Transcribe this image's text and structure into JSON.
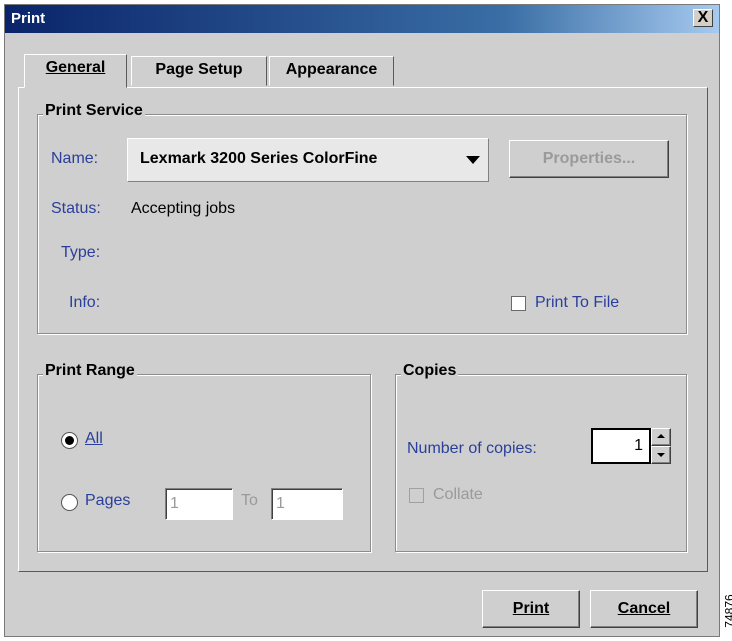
{
  "window": {
    "title": "Print",
    "close_glyph": "X"
  },
  "tabs": [
    {
      "label": "General",
      "selected": true
    },
    {
      "label": "Page Setup",
      "selected": false
    },
    {
      "label": "Appearance",
      "selected": false
    }
  ],
  "print_service": {
    "legend": "Print Service",
    "name_label": "Name:",
    "printer_name": "Lexmark 3200 Series ColorFine",
    "properties_button": "Properties...",
    "status_label": "Status:",
    "status_value": "Accepting jobs",
    "type_label": "Type:",
    "info_label": "Info:",
    "print_to_file_label": "Print To File",
    "print_to_file_checked": false
  },
  "print_range": {
    "legend": "Print Range",
    "all_label": "All",
    "all_selected": true,
    "pages_label": "Pages",
    "from_value": "1",
    "to_label": "To",
    "to_value": "1"
  },
  "copies": {
    "legend": "Copies",
    "number_label": "Number of copies:",
    "number_value": "1",
    "collate_label": "Collate",
    "collate_checked": false
  },
  "buttons": {
    "print": "Print",
    "cancel": "Cancel"
  },
  "side_id": "74876",
  "colors": {
    "title_bar": "#0a246a",
    "label_blue": "#2a3f9a",
    "dialog_bg": "#cfcfcf"
  }
}
